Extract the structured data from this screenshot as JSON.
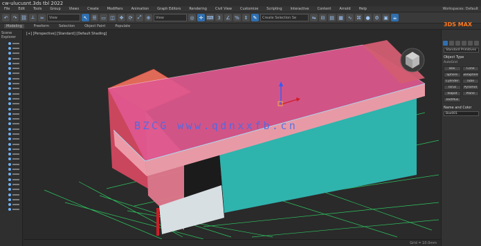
{
  "window": {
    "title": "cw-ulucusnt.3ds tbl 2022"
  },
  "menu": {
    "items": [
      "File",
      "Edit",
      "Tools",
      "Group",
      "Views",
      "Create",
      "Modifiers",
      "Animation",
      "Graph Editors",
      "Rendering",
      "Civil View",
      "Customize",
      "Scripting",
      "Interactive",
      "Content",
      "Arnold",
      "Help"
    ],
    "workspace": "Workspaces: Default"
  },
  "toolbar": {
    "selection_set": "Create Selection Se",
    "view_dropdown": "View"
  },
  "ribbon": {
    "items": [
      "Modeling",
      "Freeform",
      "Selection",
      "Object Paint",
      "Populate"
    ]
  },
  "explorer": {
    "header": "Scene Explorer"
  },
  "viewport": {
    "label": "[+] [Perspective] [Standard] [Default Shading]"
  },
  "command_panel": {
    "brand": "3DS MAX",
    "category": "Standard Primitives",
    "rollout_object_type": "Object Type",
    "autogrid": "AutoGrid",
    "buttons": [
      "Box",
      "Cone",
      "Sphere",
      "GeoSphere",
      "Cylinder",
      "Tube",
      "Torus",
      "Pyramid",
      "Teapot",
      "Plane",
      "TextPlus"
    ],
    "rollout_name_color": "Name and Color",
    "name_value": "Box001"
  },
  "watermark": "BZCG  www.qdnxxfb.cn",
  "status": "Grid = 10.0mm",
  "colors": {
    "roof": "#e0588f",
    "wall_teal": "#2fb3ad",
    "wall_salmon": "#e27a72",
    "grid_green": "#2fe36a",
    "door_white": "#d7dfe2",
    "watermark": "#3d6df2"
  }
}
